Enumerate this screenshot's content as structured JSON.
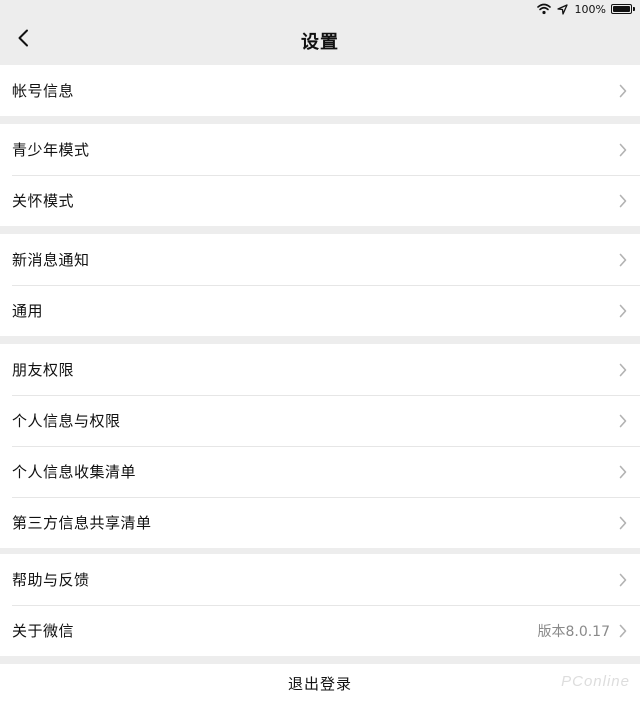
{
  "status_bar": {
    "battery_text": "100%",
    "wifi_icon": "wifi-icon",
    "location_icon": "location-arrow-icon",
    "battery_icon": "battery-full-icon"
  },
  "nav": {
    "title": "设置",
    "back_icon": "chevron-left-icon"
  },
  "groups": [
    {
      "items": [
        {
          "label": "帐号信息",
          "value": ""
        }
      ]
    },
    {
      "items": [
        {
          "label": "青少年模式",
          "value": ""
        },
        {
          "label": "关怀模式",
          "value": ""
        }
      ]
    },
    {
      "items": [
        {
          "label": "新消息通知",
          "value": ""
        },
        {
          "label": "通用",
          "value": ""
        }
      ]
    },
    {
      "items": [
        {
          "label": "朋友权限",
          "value": ""
        },
        {
          "label": "个人信息与权限",
          "value": ""
        },
        {
          "label": "个人信息收集清单",
          "value": ""
        },
        {
          "label": "第三方信息共享清单",
          "value": ""
        }
      ]
    },
    {
      "items": [
        {
          "label": "帮助与反馈",
          "value": ""
        },
        {
          "label": "关于微信",
          "value": "版本8.0.17"
        }
      ]
    }
  ],
  "logout": {
    "label": "退出登录"
  },
  "watermark": {
    "text": "PConline"
  },
  "colors": {
    "background": "#ededed",
    "cell_background": "#ffffff",
    "separator": "#e6e6e6",
    "chevron": "#b2b2b2",
    "secondary_text": "#8a8a8a"
  }
}
